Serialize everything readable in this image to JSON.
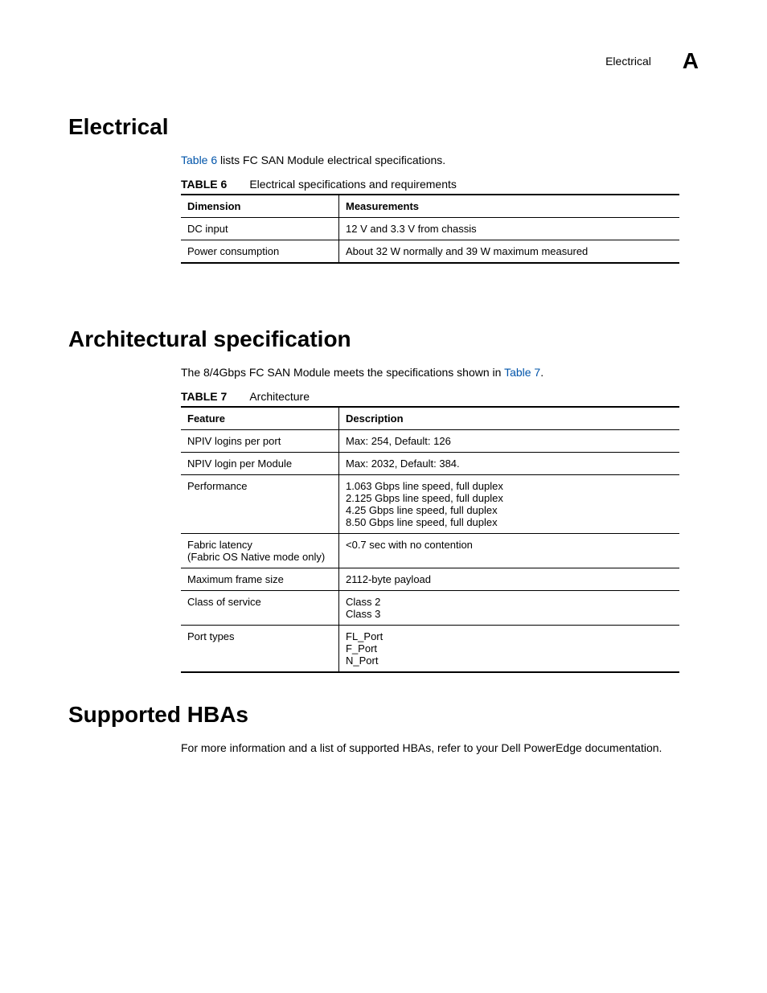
{
  "header": {
    "label": "Electrical",
    "appendix": "A"
  },
  "section1": {
    "heading": "Electrical",
    "intro_pre": "",
    "table_link": "Table 6",
    "intro_post": " lists FC SAN Module electrical specifications.",
    "table_num": "TABLE 6",
    "table_title": "Electrical specifications and requirements",
    "th1": "Dimension",
    "th2": "Measurements",
    "rows": [
      {
        "c1": "DC input",
        "c2": "12 V and 3.3 V from chassis"
      },
      {
        "c1": "Power consumption",
        "c2": "About 32 W normally and 39 W maximum measured"
      }
    ]
  },
  "section2": {
    "heading": "Architectural specification",
    "intro_pre": "The 8/4Gbps FC SAN Module meets the specifications shown in ",
    "table_link": "Table 7",
    "intro_post": ".",
    "table_num": "TABLE 7",
    "table_title": "Architecture",
    "th1": "Feature",
    "th2": "Description",
    "rows": [
      {
        "c1": "NPIV logins per port",
        "c2": "Max: 254, Default: 126"
      },
      {
        "c1": "NPIV login per Module",
        "c2": "Max: 2032, Default:   384."
      },
      {
        "c1": "Performance",
        "c2": "1.063 Gbps line speed, full duplex\n2.125 Gbps line speed, full duplex\n4.25 Gbps line speed, full duplex\n8.50 Gbps line speed, full duplex"
      },
      {
        "c1": "Fabric latency\n(Fabric OS Native mode only)",
        "c2": "<0.7 sec with no contention"
      },
      {
        "c1": "Maximum frame size",
        "c2": "2112-byte payload"
      },
      {
        "c1": "Class of service",
        "c2": "Class 2\nClass 3"
      },
      {
        "c1": "Port types",
        "c2": "FL_Port\nF_Port\nN_Port"
      }
    ]
  },
  "section3": {
    "heading": "Supported HBAs",
    "body": "For more information and a list of supported HBAs, refer to your Dell PowerEdge documentation."
  }
}
